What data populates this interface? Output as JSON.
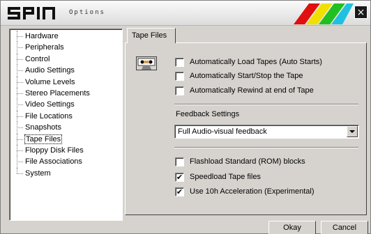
{
  "window": {
    "title_logo": "SPIN",
    "title_subtitle": "Options",
    "close_label": "×",
    "stripe_colors": [
      "#e01010",
      "#f0e000",
      "#20c020",
      "#20c0e0"
    ]
  },
  "tree": {
    "items": [
      {
        "label": "Hardware"
      },
      {
        "label": "Peripherals"
      },
      {
        "label": "Control"
      },
      {
        "label": "Audio Settings"
      },
      {
        "label": "Volume Levels"
      },
      {
        "label": "Stereo Placements"
      },
      {
        "label": "Video Settings"
      },
      {
        "label": "File Locations"
      },
      {
        "label": "Snapshots"
      },
      {
        "label": "Tape Files",
        "selected": true
      },
      {
        "label": "Floppy Disk Files"
      },
      {
        "label": "File Associations"
      },
      {
        "label": "System"
      }
    ]
  },
  "tab": {
    "label": "Tape Files"
  },
  "options": {
    "auto_load": {
      "label": "Automatically Load Tapes (Auto Starts)",
      "checked": false
    },
    "auto_start_stop": {
      "label": "Automatically Start/Stop the Tape",
      "checked": false
    },
    "auto_rewind": {
      "label": "Automatically Rewind at end of Tape",
      "checked": false
    },
    "feedback_label": "Feedback Settings",
    "feedback_value": "Full Audio-visual feedback",
    "flashload": {
      "label": "Flashload Standard (ROM) blocks",
      "checked": false
    },
    "speedload": {
      "label": "Speedload Tape files",
      "checked": true
    },
    "accel": {
      "label": "Use 10h Acceleration (Experimental)",
      "checked": true
    },
    "check_mark": "✔"
  },
  "buttons": {
    "okay": "Okay",
    "cancel": "Cancel"
  }
}
